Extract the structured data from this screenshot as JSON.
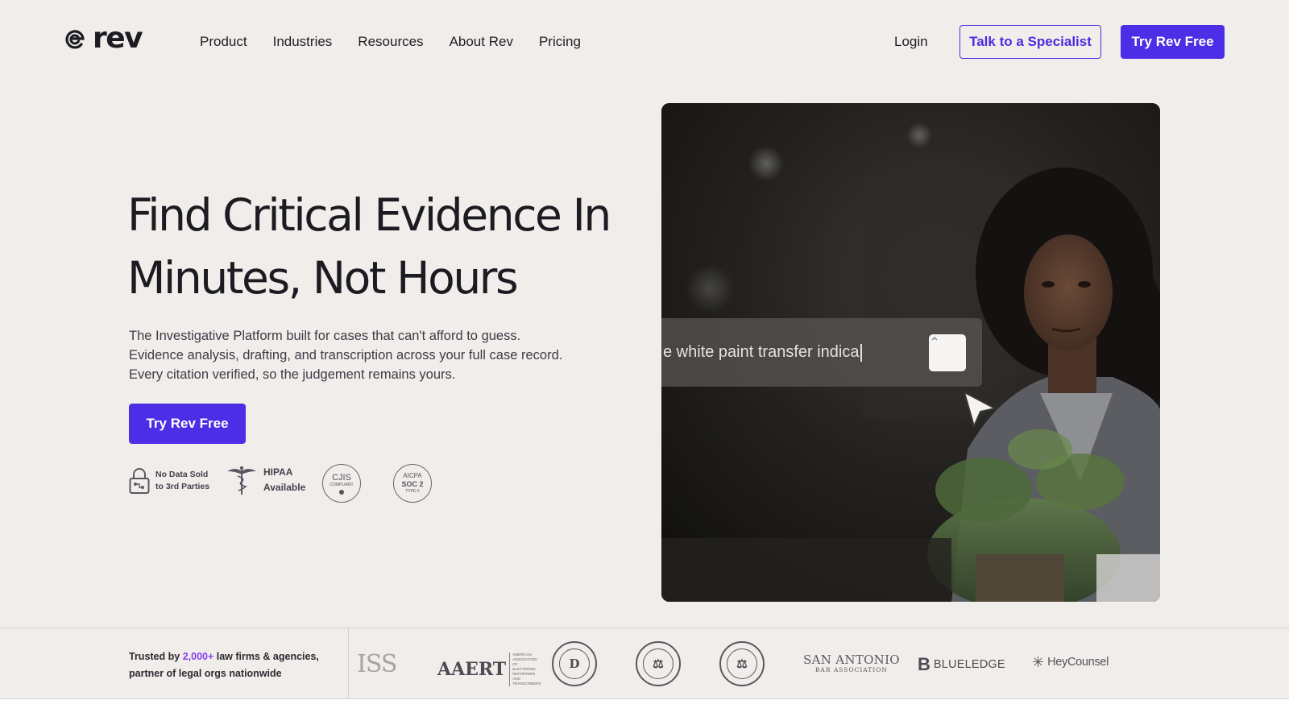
{
  "header": {
    "logo_text": "rev",
    "nav": [
      "Product",
      "Industries",
      "Resources",
      "About Rev",
      "Pricing"
    ],
    "login_label": "Login",
    "specialist_label": "Talk to a Specialist",
    "try_label": "Try Rev Free"
  },
  "hero": {
    "title_line1": "Find Critical Evidence In",
    "title_line2": "Minutes, Not Hours",
    "subtitle": [
      "The Investigative Platform built for cases that can't afford to guess.",
      "Evidence analysis, drafting, and transcription across your full case record.",
      "Every citation verified, so the judgement remains yours."
    ],
    "cta_label": "Try Rev Free",
    "badges": {
      "no_data_line1": "No Data Sold",
      "no_data_line2": "to 3rd Parties",
      "hipaa_line1": "HIPAA",
      "hipaa_line2": "Available",
      "cjis_line1": "CJIS",
      "cjis_line2": "COMPLIANT",
      "soc_line1": "AICPA",
      "soc_line2": "SOC 2",
      "soc_line3": "TYPE II"
    }
  },
  "video": {
    "search_text": "e white paint transfer indica"
  },
  "trust": {
    "prefix": "Trusted by ",
    "count": "2,000+",
    "suffix": " law firms & agencies,",
    "line2": "partner of legal orgs nationwide",
    "logos": {
      "iss": "ISS",
      "aaert": "AAERT",
      "aaert_small": "AMERICAN ASSOCIATION OF ELECTRONIC REPORTERS AND TRANSCRIBERS",
      "san_antonio_line1": "SAN ANTONIO",
      "san_antonio_line2": "BAR ASSOCIATION",
      "blueledge": "BLUELEDGE",
      "heycounsel": "HeyCounsel"
    }
  },
  "colors": {
    "background": "#f0edea",
    "brand": "#4b2ee6",
    "highlight": "#8a3ff0",
    "text": "#1c1b22"
  }
}
